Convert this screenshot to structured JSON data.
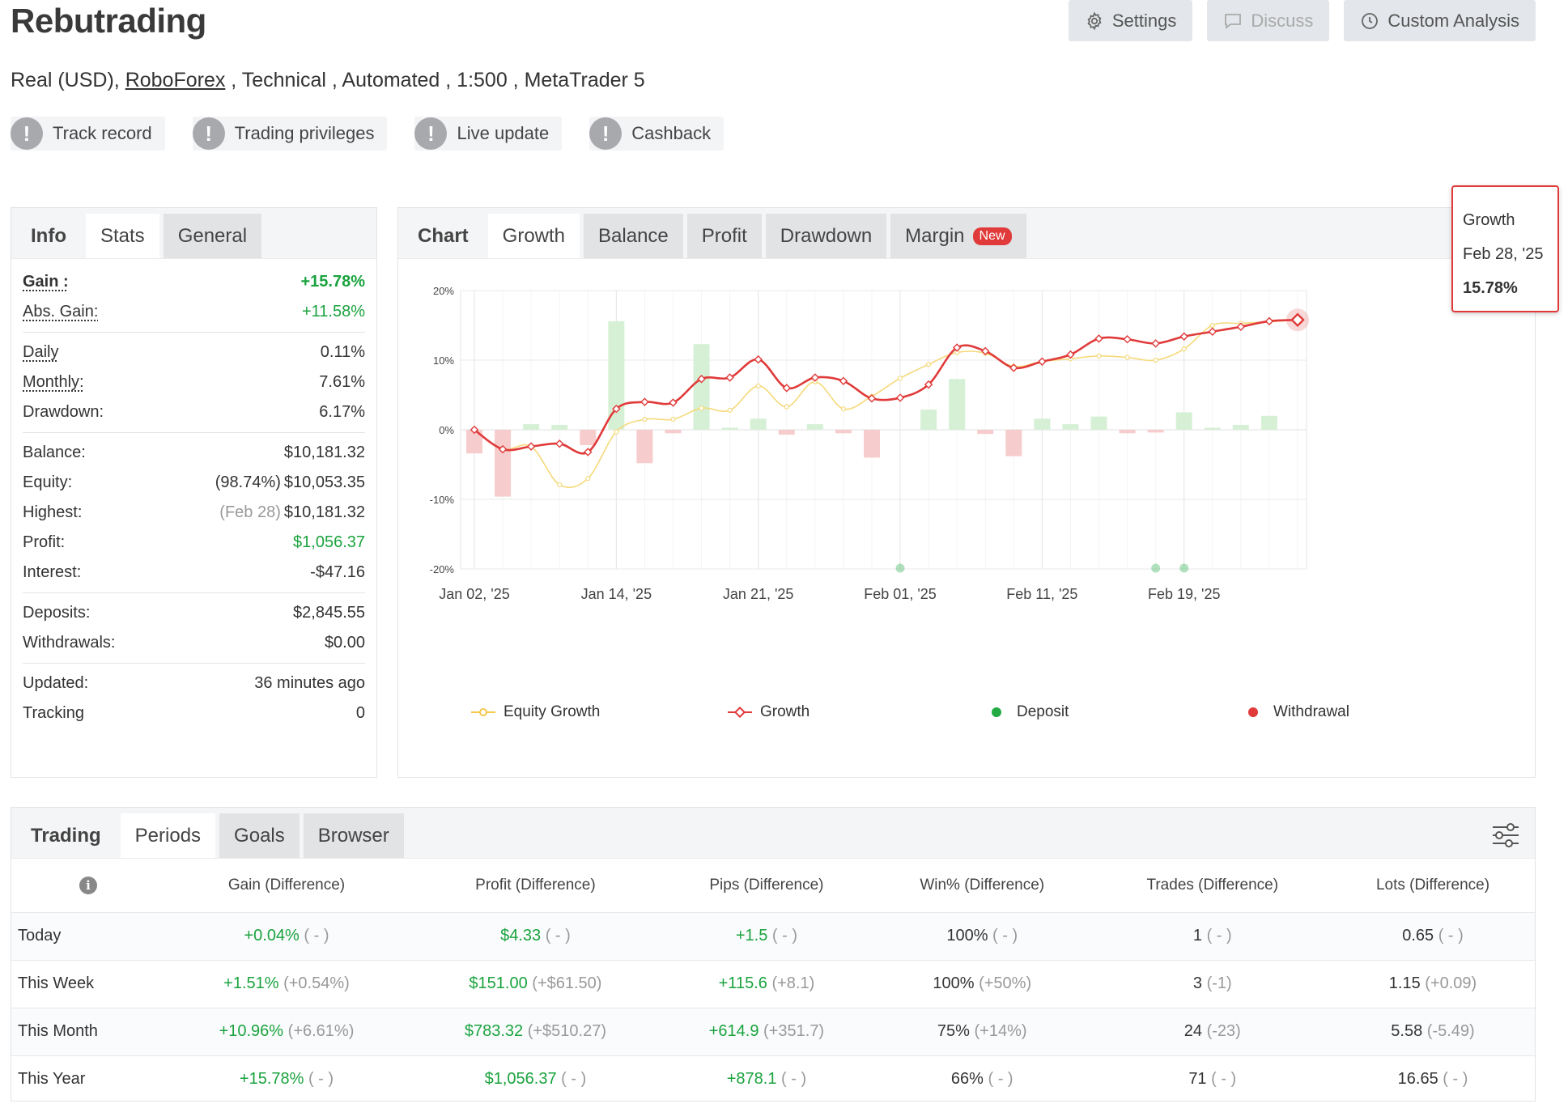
{
  "header": {
    "title": "Rebutrading",
    "subtitle_prefix": "Real (USD), ",
    "broker": "RoboForex",
    "subtitle_suffix": " , Technical , Automated , 1:500 , MetaTrader 5",
    "buttons": [
      {
        "label": "Settings",
        "icon": "gear-icon"
      },
      {
        "label": "Discuss",
        "icon": "chat-icon"
      },
      {
        "label": "Custom Analysis",
        "icon": "clock-icon"
      }
    ],
    "badges": [
      "Track record",
      "Trading privileges",
      "Live update",
      "Cashback"
    ]
  },
  "info": {
    "tab_head": "Info",
    "tabs": [
      "Stats",
      "General"
    ],
    "rows": [
      {
        "label": "Gain :",
        "value": "+15.78%"
      },
      {
        "label": "Abs. Gain:",
        "value": "+11.58%"
      },
      {
        "label": "Daily",
        "value": "0.11%"
      },
      {
        "label": "Monthly:",
        "value": "7.61%"
      },
      {
        "label": "Drawdown:",
        "value": "6.17%"
      },
      {
        "label": "Balance:",
        "value": "$10,181.32"
      },
      {
        "label": "Equity:",
        "note": "(98.74%)",
        "value": "$10,053.35"
      },
      {
        "label": "Highest:",
        "note": "(Feb 28)",
        "value": "$10,181.32"
      },
      {
        "label": "Profit:",
        "value": "$1,056.37"
      },
      {
        "label": "Interest:",
        "value": "-$47.16"
      },
      {
        "label": "Deposits:",
        "value": "$2,845.55"
      },
      {
        "label": "Withdrawals:",
        "value": "$0.00"
      },
      {
        "label": "Updated:",
        "value": "36 minutes ago"
      },
      {
        "label": "Tracking",
        "value": "0"
      }
    ]
  },
  "chart": {
    "tab_head": "Chart",
    "tabs": [
      "Growth",
      "Balance",
      "Profit",
      "Drawdown",
      "Margin"
    ],
    "new_badge": "New",
    "tooltip": {
      "series": "Growth",
      "date": "Feb 28, '25",
      "value": "15.78%"
    }
  },
  "chart_data": {
    "type": "line",
    "y_ticks": [
      "20%",
      "10%",
      "0%",
      "-10%",
      "-20%"
    ],
    "ylim": [
      -20,
      20
    ],
    "x_ticks": [
      "Jan 02, '25",
      "Jan 14, '25",
      "Jan 21, '25",
      "Feb 01, '25",
      "Feb 11, '25",
      "Feb 19, '25"
    ],
    "legend": [
      "Equity Growth",
      "Growth",
      "Deposit",
      "Withdrawal"
    ],
    "colors": {
      "growth": "#e03a3a",
      "equity": "#f5d97a",
      "deposit": "#22aa44",
      "withdrawal": "#e03a3a",
      "bar_pos": "#d6f0d6",
      "bar_neg": "#f7cccc"
    },
    "growth": [
      0,
      -2.8,
      -2.4,
      -2.0,
      -3.2,
      3.0,
      4.0,
      3.9,
      7.3,
      7.5,
      10.1,
      6.0,
      7.5,
      7.0,
      4.5,
      4.6,
      6.5,
      11.8,
      11.3,
      8.9,
      9.8,
      10.8,
      13.1,
      13.0,
      12.4,
      13.4,
      14.1,
      14.8,
      15.6,
      15.78
    ],
    "equity": [
      0,
      -2.8,
      -2.4,
      -7.9,
      -7.0,
      -0.3,
      1.5,
      1.5,
      3.1,
      2.8,
      6.3,
      3.3,
      6.9,
      3.0,
      4.8,
      7.4,
      9.4,
      11.1,
      11.0,
      9.1,
      9.8,
      10.2,
      10.6,
      10.4,
      10.0,
      11.6,
      15.0,
      15.3,
      15.5,
      15.8
    ],
    "bars": [
      -3.4,
      -9.6,
      0.8,
      0.7,
      -2.2,
      15.6,
      -4.8,
      -0.5,
      12.3,
      0.3,
      1.6,
      -0.7,
      0.8,
      -0.5,
      -4.0,
      0,
      2.9,
      7.3,
      -0.6,
      -3.8,
      1.6,
      0.8,
      1.9,
      -0.5,
      -0.4,
      2.5,
      0.3,
      0.7,
      2.0,
      0
    ],
    "deposit_indices": [
      15,
      24,
      25
    ]
  },
  "trading": {
    "tab_head": "Trading",
    "tabs": [
      "Periods",
      "Goals",
      "Browser"
    ],
    "columns": [
      "Gain (Difference)",
      "Profit (Difference)",
      "Pips (Difference)",
      "Win% (Difference)",
      "Trades (Difference)",
      "Lots (Difference)"
    ],
    "rows": [
      {
        "period": "Today",
        "gain": "+0.04%",
        "gain_d": "( - )",
        "profit": "$4.33",
        "profit_d": "( - )",
        "pips": "+1.5",
        "pips_d": "( - )",
        "win": "100%",
        "win_d": "( - )",
        "trades": "1",
        "trades_d": "( - )",
        "lots": "0.65",
        "lots_d": "( - )"
      },
      {
        "period": "This Week",
        "gain": "+1.51%",
        "gain_d": "(+0.54%)",
        "profit": "$151.00",
        "profit_d": "(+$61.50)",
        "pips": "+115.6",
        "pips_d": "(+8.1)",
        "win": "100%",
        "win_d": "(+50%)",
        "trades": "3",
        "trades_d": "(-1)",
        "lots": "1.15",
        "lots_d": "(+0.09)"
      },
      {
        "period": "This Month",
        "gain": "+10.96%",
        "gain_d": "(+6.61%)",
        "profit": "$783.32",
        "profit_d": "(+$510.27)",
        "pips": "+614.9",
        "pips_d": "(+351.7)",
        "win": "75%",
        "win_d": "(+14%)",
        "trades": "24",
        "trades_d": "(-23)",
        "lots": "5.58",
        "lots_d": "(-5.49)"
      },
      {
        "period": "This Year",
        "gain": "+15.78%",
        "gain_d": "( - )",
        "profit": "$1,056.37",
        "profit_d": "( - )",
        "pips": "+878.1",
        "pips_d": "( - )",
        "win": "66%",
        "win_d": "( - )",
        "trades": "71",
        "trades_d": "( - )",
        "lots": "16.65",
        "lots_d": "( - )"
      }
    ]
  }
}
